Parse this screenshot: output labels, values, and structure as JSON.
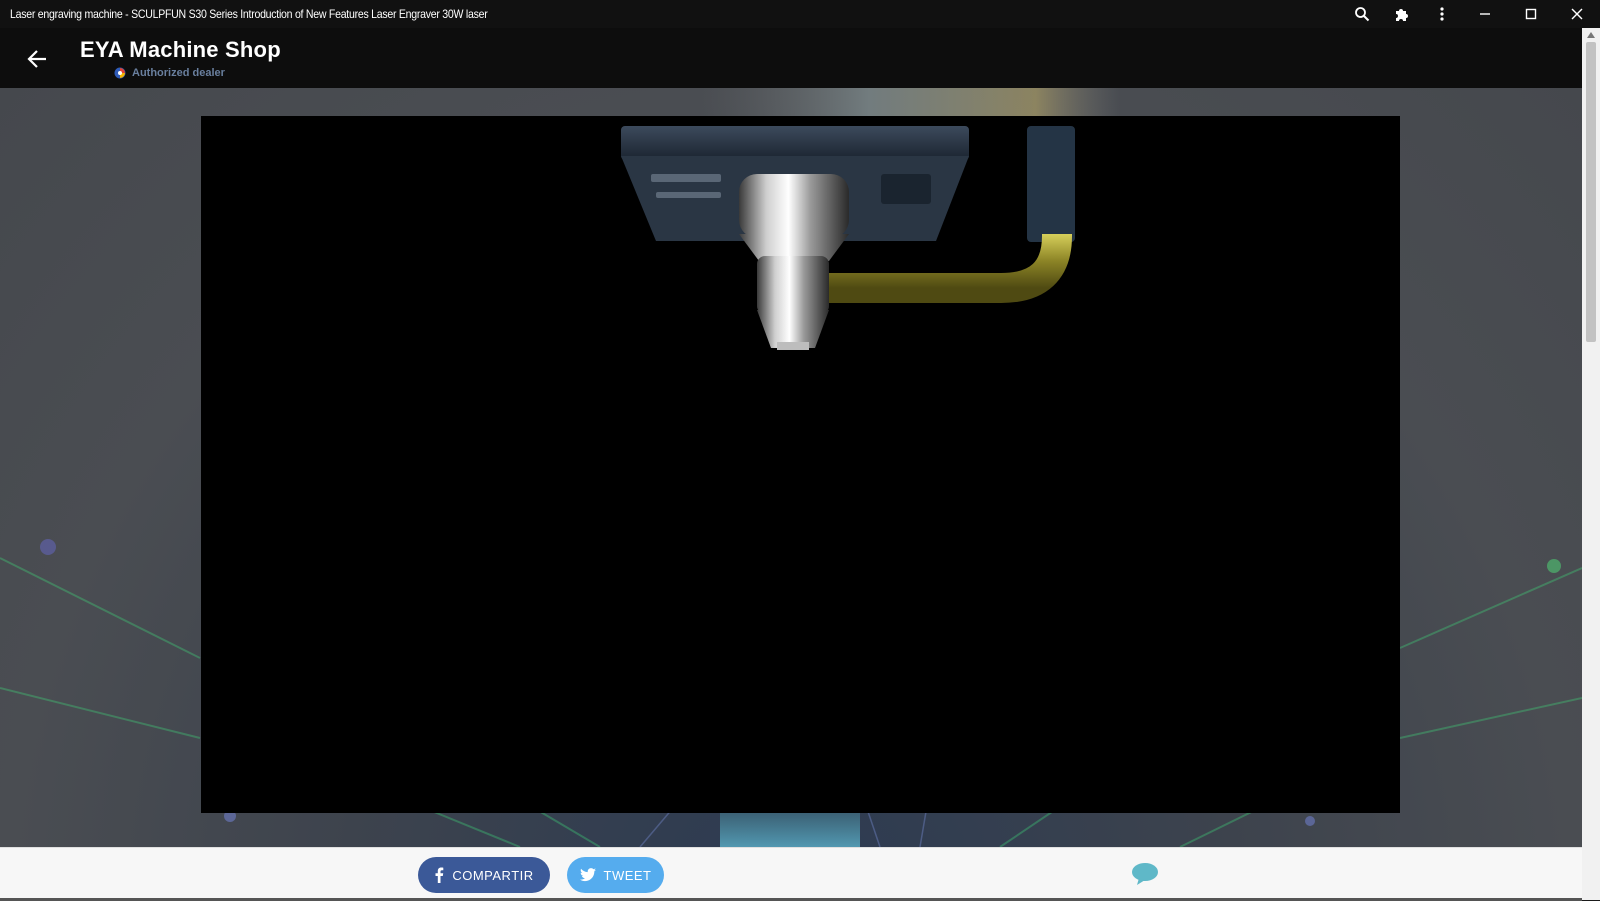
{
  "window": {
    "title": "Laser engraving machine - SCULPFUN S30 Series Introduction of New Features Laser Engraver 30W laser",
    "controls": [
      "search-icon",
      "extensions-icon",
      "more-vert-icon",
      "minimize-icon",
      "maximize-icon",
      "close-icon"
    ]
  },
  "appbar": {
    "shop_name": "EYA Machine Shop",
    "dealer_label": "Authorized dealer"
  },
  "video": {
    "content": "laser-head-render"
  },
  "footer": {
    "share_facebook": "COMPARTIR",
    "share_twitter": "TWEET"
  },
  "colors": {
    "facebook": "#3b5998",
    "twitter": "#55acee",
    "appbar": "#0d0d0d",
    "comment": "#5fb8c8"
  }
}
